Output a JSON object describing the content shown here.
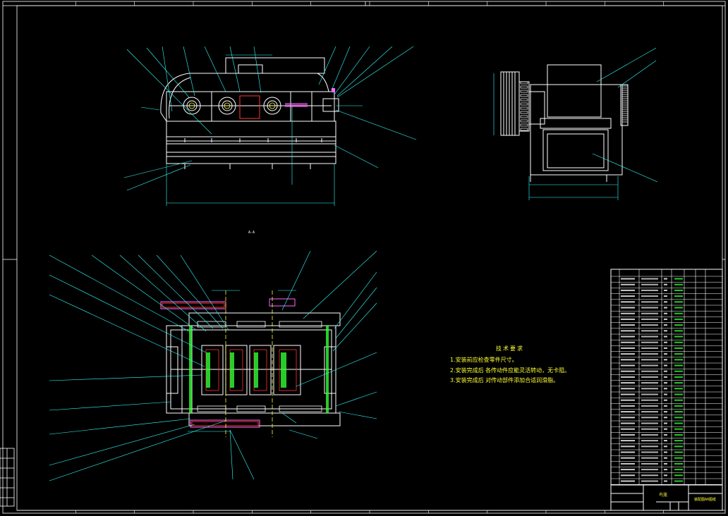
{
  "notes": {
    "title": "技术要求",
    "items": [
      "1.安装前应检查零件尺寸。",
      "2.安装完成后 各传动件应能灵活转动，无卡阻。",
      "3.安装完成后 对传动部件添加合适润滑脂。"
    ]
  },
  "title_block": {
    "name": "鸟笼",
    "drawing_no": "装配图A0图纸"
  },
  "section_mark": "A-A",
  "colors": {
    "frame": "#ffffff",
    "part": "#ffffff",
    "dim": "#33ffff",
    "leader": "#33ffff",
    "text": "#ffff33",
    "red": "#ff3333",
    "green": "#33ff33",
    "magenta": "#ff66ff"
  }
}
